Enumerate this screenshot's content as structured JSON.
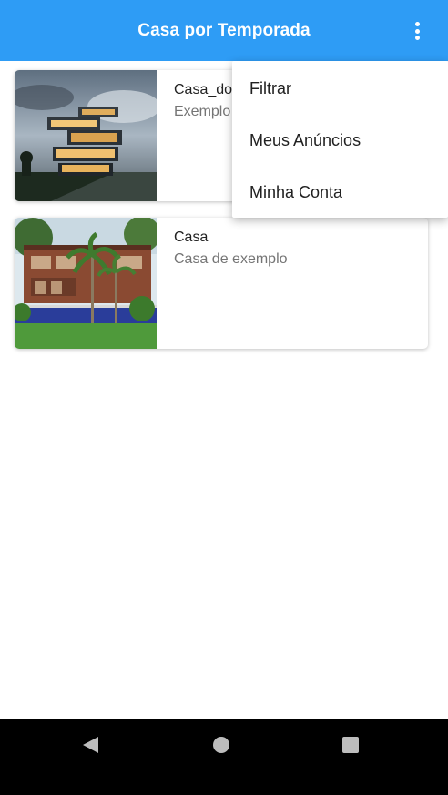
{
  "appbar": {
    "title": "Casa por Temporada",
    "menu_icon": "more-vert-icon",
    "color": "#2e9cf5"
  },
  "listings": [
    {
      "title": "Casa_do",
      "subtitle": "Exemplo",
      "image": "modern-stacked-house-photo"
    },
    {
      "title": "Casa",
      "subtitle": "Casa de exemplo",
      "image": "tropical-house-pool-photo"
    }
  ],
  "menu": {
    "items": [
      {
        "label": "Filtrar"
      },
      {
        "label": "Meus Anúncios"
      },
      {
        "label": "Minha Conta"
      }
    ]
  },
  "navbar": {
    "back_icon": "back-triangle-icon",
    "home_icon": "home-circle-icon",
    "recents_icon": "recents-square-icon"
  }
}
